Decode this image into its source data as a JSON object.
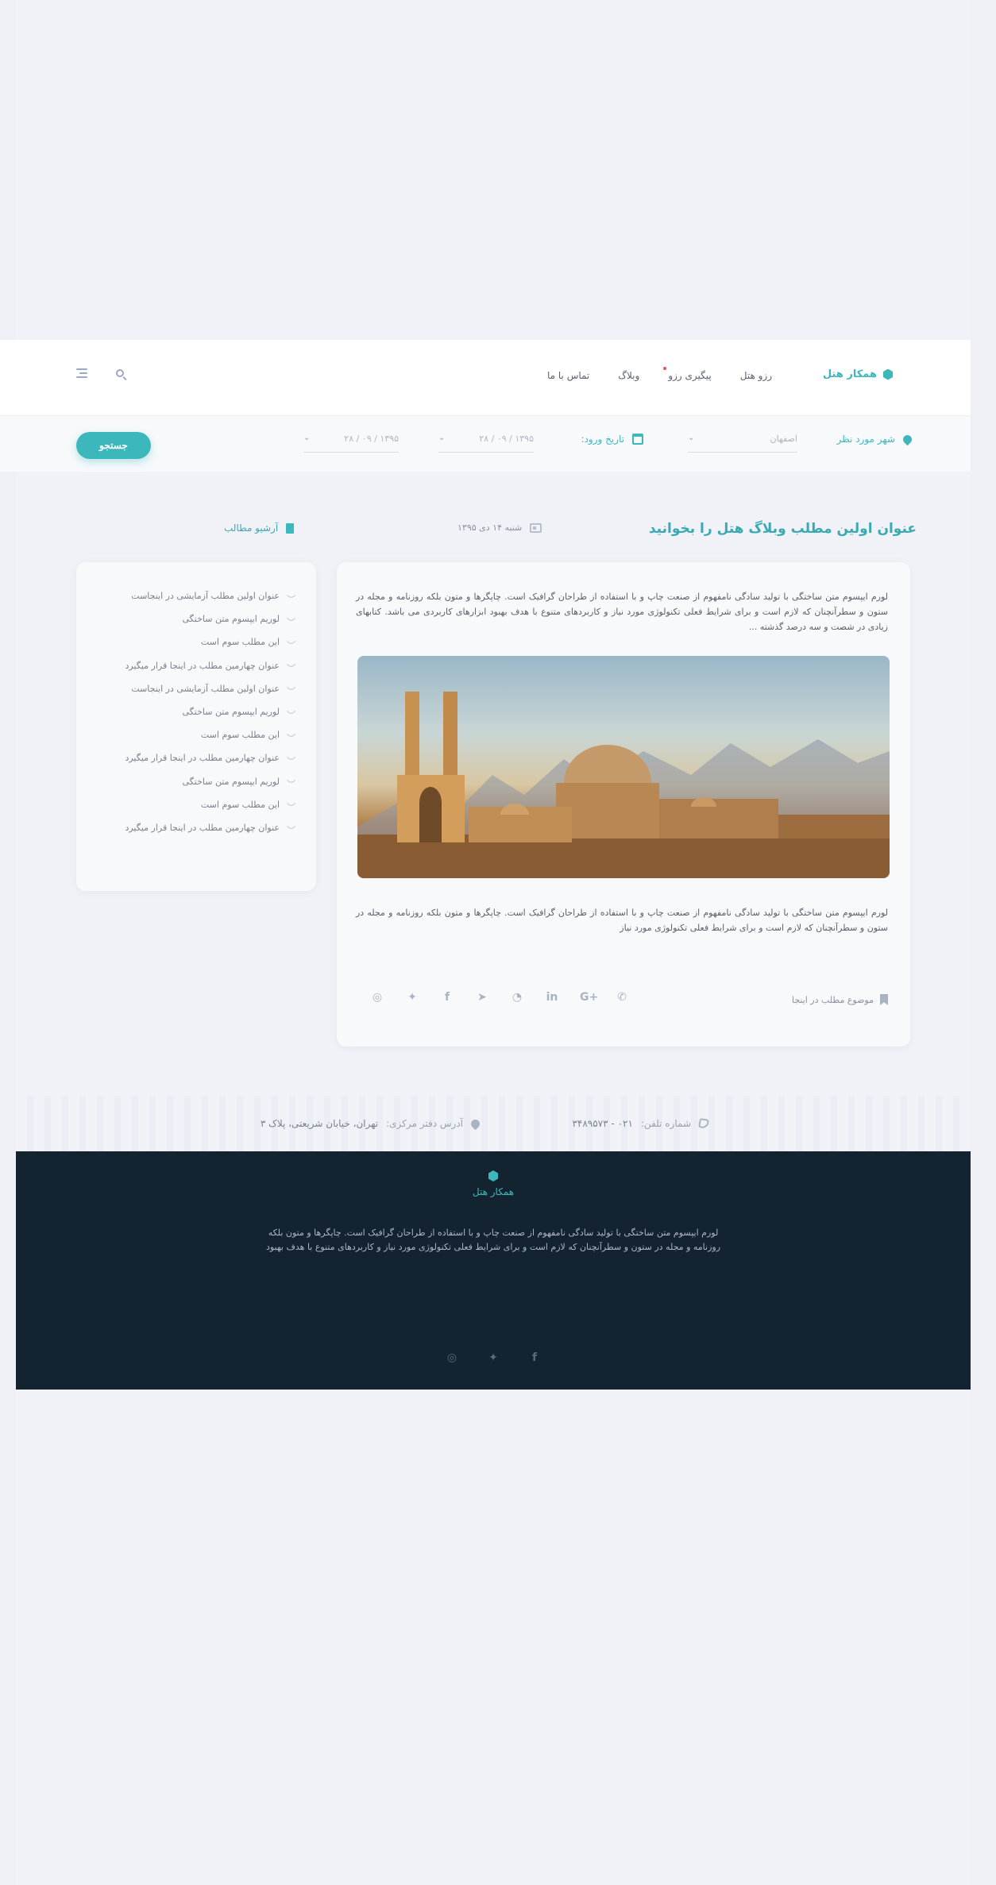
{
  "header": {
    "brand_name": "همکار هتل",
    "nav": [
      {
        "label": "رزو هتل"
      },
      {
        "label": "پیگیری رزو"
      },
      {
        "label": "وبلاگ"
      },
      {
        "label": "تماس با ما"
      }
    ]
  },
  "search": {
    "city_label": "شهر مورد نظر",
    "city_placeholder": "اصفهان",
    "checkin_label": "تاریخ ورود:",
    "date1": "۱۳۹۵ / ۰۹ / ۲۸",
    "date2": "۱۳۹۵ / ۰۹ / ۲۸",
    "button": "جستجو"
  },
  "post": {
    "title": "عنوان اولین مطلب وبلاگ هتل را بخوانید",
    "date": "شنبه ۱۴ دی ۱۳۹۵",
    "paragraph1": "لورم ایپسوم متن ساختگی با تولید سادگی نامفهوم از صنعت چاپ و با استفاده از طراحان گرافیک است. چاپگرها و متون بلکه روزنامه و مجله در ستون و سطرآنچنان که لازم است و برای شرایط فعلی تکنولوژی مورد نیاز و کاربردهای متنوع با هدف بهبود ابزارهای کاربردی می باشد. کتابهای زیادی در شصت و سه درصد گذشته ...",
    "paragraph2": "لورم ایپسوم متن ساختگی با تولید سادگی نامفهوم از صنعت چاپ و با استفاده از طراحان گرافیک است. چاپگرها و متون بلکه روزنامه و مجله در ستون و سطرآنچنان که لازم است و برای شرایط فعلی تکنولوژی مورد نیاز",
    "tag": "موضوع مطلب در اینجا",
    "share_icons": [
      "instagram-icon",
      "twitter-icon",
      "facebook-icon",
      "telegram-icon",
      "whatsapp-icon",
      "linkedin-icon",
      "google-plus-icon",
      "phone-icon"
    ]
  },
  "sidebar": {
    "title": "آرشیو مطالب",
    "items": [
      "عنوان اولین مطلب آزمایشی در اینجاست",
      "لوریم ایپسوم متن ساختگی",
      "این مطلب سوم است",
      "عنوان چهارمین مطلب در اینجا قرار میگیرد",
      "عنوان اولین مطلب آزمایشی در اینجاست",
      "لوریم ایپسوم متن ساختگی",
      "این مطلب سوم است",
      "عنوان چهارمین مطلب در اینجا قرار میگیرد",
      "لوریم ایپسوم متن ساختگی",
      "این مطلب سوم است",
      "عنوان چهارمین مطلب در اینجا قرار میگیرد"
    ]
  },
  "contact": {
    "phone_label": "شماره تلفن:",
    "phone": "۰۲۱ - ۳۴۸۹۵۷۳",
    "address_label": "آدرس دفتر مرکزی:",
    "address": "تهران، خیابان شریعتی، پلاک ۳"
  },
  "footer": {
    "brand_name": "همکار هتل",
    "text": "لورم ایپسوم متن ساختگی با تولید سادگی نامفهوم از صنعت چاپ و با استفاده از طراحان گرافیک است. چاپگرها و متون بلکه روزنامه و مجله در ستون و سطرآنچنان که لازم است و برای شرایط فعلی تکنولوژی مورد نیاز و کاربردهای متنوع با هدف بهبود"
  },
  "colors": {
    "accent": "#3cb8bd",
    "footer_bg": "#13232f",
    "page_bg": "#eef0f5"
  }
}
